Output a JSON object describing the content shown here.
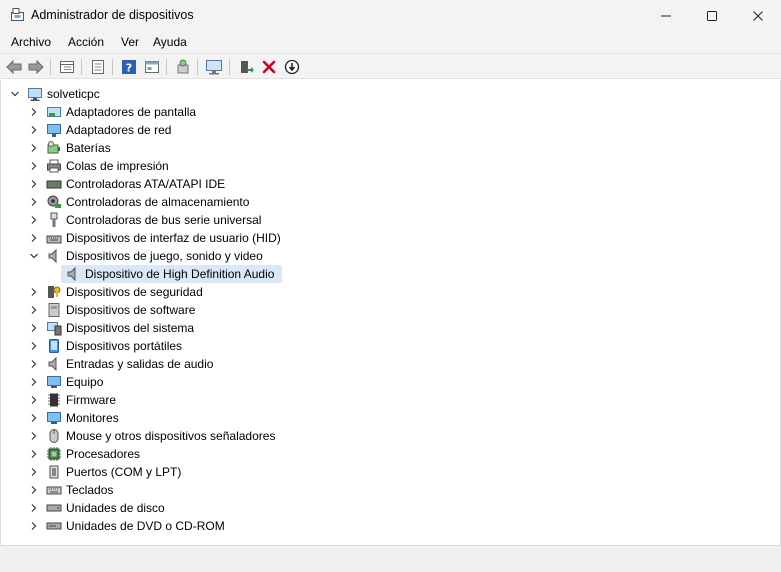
{
  "window": {
    "title": "Administrador de dispositivos"
  },
  "menu": [
    "Archivo",
    "Acción",
    "Ver",
    "Ayuda"
  ],
  "toolbar": {
    "icons": [
      "back-arrow-icon",
      "forward-arrow-icon",
      "properties-grid-icon",
      "device-list-icon",
      "help-icon",
      "details-icon",
      "update-driver-icon",
      "scan-monitor-icon",
      "enable-device-icon",
      "uninstall-x-icon",
      "download-icon"
    ]
  },
  "tree": {
    "root": "solveticpc",
    "categories": [
      "Adaptadores de pantalla",
      "Adaptadores de red",
      "Baterías",
      "Colas de impresión",
      "Controladoras ATA/ATAPI IDE",
      "Controladoras de almacenamiento",
      "Controladoras de bus serie universal",
      "Dispositivos de interfaz de usuario (HID)",
      "Dispositivos de juego, sonido y video",
      "Dispositivo de High Definition Audio",
      "Dispositivos de seguridad",
      "Dispositivos de software",
      "Dispositivos del sistema",
      "Dispositivos portátiles",
      "Entradas y salidas de audio",
      "Equipo",
      "Firmware",
      "Monitores",
      "Mouse y otros dispositivos señaladores",
      "Procesadores",
      "Puertos (COM y LPT)",
      "Teclados",
      "Unidades de disco",
      "Unidades de DVD o CD-ROM"
    ]
  },
  "colors": {
    "selection": "#d9e8f7",
    "accent": "#2a78c8",
    "danger": "#d0021b"
  }
}
